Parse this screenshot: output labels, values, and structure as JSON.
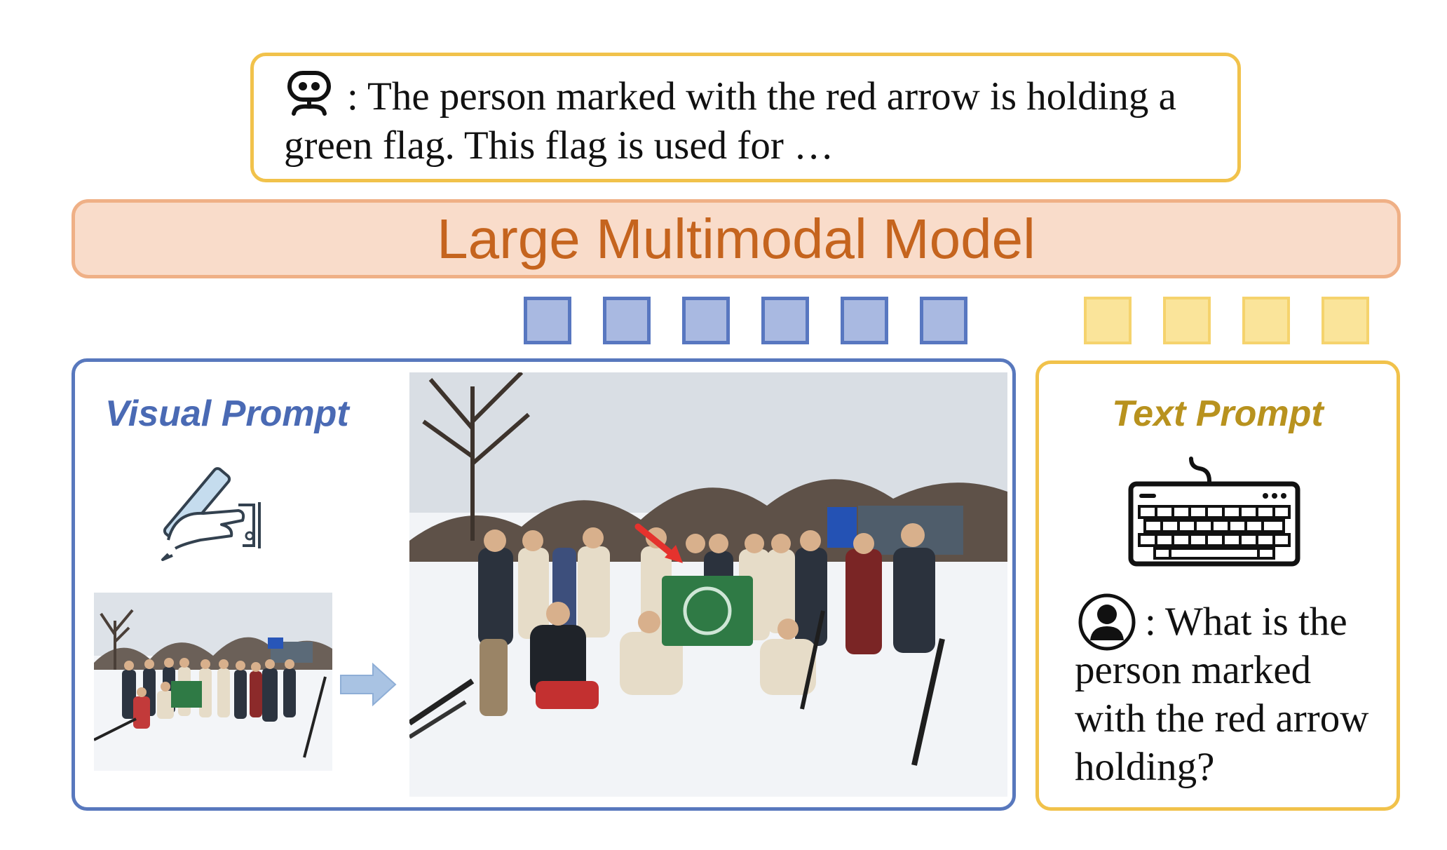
{
  "output": {
    "icon": "robot-icon",
    "text": ": The person marked with the red arrow is holding a green flag. This flag is used for …"
  },
  "model": {
    "label": "Large Multimodal Model"
  },
  "tokens": {
    "visual_count": 6,
    "text_count": 4
  },
  "visual_prompt": {
    "title": "Visual Prompt",
    "icons": [
      "hand-pen-icon",
      "right-arrow-icon"
    ],
    "images": [
      "ski-group-photo-thumbnail",
      "ski-group-photo-with-red-arrow"
    ]
  },
  "text_prompt": {
    "title": "Text Prompt",
    "icons": [
      "keyboard-icon",
      "user-icon"
    ],
    "question": ": What is the person marked with the red arrow holding?"
  },
  "colors": {
    "output_border": "#f1c24b",
    "model_fill": "#f9dcca",
    "model_border": "#efb086",
    "model_text": "#c5641e",
    "visual_accent": "#5878bd",
    "visual_token_fill": "#a9b9e1",
    "text_accent": "#b8921e",
    "text_token_fill": "#fae49a",
    "arrow_red": "#e5322d",
    "flag_green": "#2f7a45"
  }
}
